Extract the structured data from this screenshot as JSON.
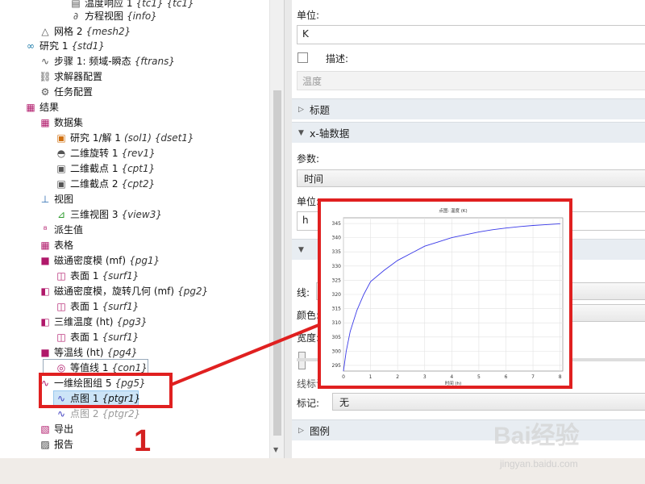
{
  "tree": {
    "rows": [
      {
        "label": "温度响应 1",
        "tag": "{tc1} {tc1}",
        "icon": "file-icon",
        "tog": ""
      },
      {
        "label": "方程视图",
        "tag": "{info}",
        "icon": "equation-icon",
        "tog": ""
      },
      {
        "label": "网格 2",
        "tag": "{mesh2}",
        "icon": "mesh-icon",
        "tog": ""
      },
      {
        "label": "研究 1",
        "tag": "{std1}",
        "icon": "study-icon",
        "tog": "◢"
      },
      {
        "label": "步骤 1: 频域-瞬态",
        "tag": "{ftrans}",
        "icon": "step-icon",
        "tog": ""
      },
      {
        "label": "求解器配置",
        "tag": "",
        "icon": "solver-icon",
        "tog": "▷"
      },
      {
        "label": "任务配置",
        "tag": "",
        "icon": "task-icon",
        "tog": ""
      },
      {
        "label": "结果",
        "tag": "",
        "icon": "results-icon",
        "tog": "◢"
      },
      {
        "label": "数据集",
        "tag": "",
        "icon": "dataset-icon",
        "tog": "◢"
      },
      {
        "label": "研究 1/解 1",
        "tag": "(sol1) {dset1}",
        "icon": "solution-icon",
        "tog": ""
      },
      {
        "label": "二维旋转 1",
        "tag": "{rev1}",
        "icon": "revolve-icon",
        "tog": ""
      },
      {
        "label": "二维截点 1",
        "tag": "{cpt1}",
        "icon": "cutpoint-icon",
        "tog": ""
      },
      {
        "label": "二维截点 2",
        "tag": "{cpt2}",
        "icon": "cutpoint-icon",
        "tog": ""
      },
      {
        "label": "视图",
        "tag": "",
        "icon": "view-icon",
        "tog": "◢"
      },
      {
        "label": "三维视图 3",
        "tag": "{view3}",
        "icon": "view3d-icon",
        "tog": "▷"
      },
      {
        "label": "派生值",
        "tag": "",
        "icon": "derived-values-icon",
        "tog": ""
      },
      {
        "label": "表格",
        "tag": "",
        "icon": "table-icon",
        "tog": ""
      },
      {
        "label": "磁通密度模 (mf)",
        "tag": "{pg1}",
        "icon": "plotgroup-2d-icon",
        "tog": "◢"
      },
      {
        "label": "表面 1",
        "tag": "{surf1}",
        "icon": "surface-icon",
        "tog": ""
      },
      {
        "label": "磁通密度模，旋转几何 (mf)",
        "tag": "{pg2}",
        "icon": "plotgroup-3d-icon",
        "tog": "◢"
      },
      {
        "label": "表面 1",
        "tag": "{surf1}",
        "icon": "surface-icon",
        "tog": ""
      },
      {
        "label": "三维温度 (ht)",
        "tag": "{pg3}",
        "icon": "plotgroup-3d-icon",
        "tog": "◢"
      },
      {
        "label": "表面 1",
        "tag": "{surf1}",
        "icon": "surface-icon",
        "tog": ""
      },
      {
        "label": "等温线 (ht)",
        "tag": "{pg4}",
        "icon": "plotgroup-2d-icon",
        "tog": "◢"
      },
      {
        "label": "等值线 1",
        "tag": "{con1}",
        "icon": "contour-icon",
        "tog": ""
      },
      {
        "label": "一维绘图组 5",
        "tag": "{pg5}",
        "icon": "plotgroup-1d-icon",
        "tog": "◢"
      },
      {
        "label": "点图 1",
        "tag": "{ptgr1}",
        "icon": "pointgraph-icon",
        "tog": ""
      },
      {
        "label": "点图 2",
        "tag": "{ptgr2}",
        "icon": "pointgraph-icon",
        "tog": ""
      },
      {
        "label": "导出",
        "tag": "",
        "icon": "export-icon",
        "tog": ""
      },
      {
        "label": "报告",
        "tag": "",
        "icon": "report-icon",
        "tog": ""
      }
    ]
  },
  "settings": {
    "unit_label": "单位:",
    "unit_value": "K",
    "desc_label": "描述:",
    "desc_value": "温度",
    "title_section": "标题",
    "xaxis_section": "x-轴数据",
    "param_label": "参数:",
    "param_value": "时间",
    "xunit_label": "单位:",
    "xunit_value": "h",
    "line_label": "线:",
    "color_label": "颜色:",
    "width_label": "宽度:",
    "marker_section": "线标记",
    "marker_label": "标记:",
    "marker_value": "无",
    "legend_section": "图例"
  },
  "annotation": {
    "number": "1"
  },
  "chart_data": {
    "type": "line",
    "title": "点图: 温度 (K)",
    "xlabel": "时间 (h)",
    "ylabel": "",
    "xlim": [
      0,
      8.1
    ],
    "ylim": [
      293,
      347
    ],
    "xticks": [
      0,
      1,
      2,
      3,
      4,
      5,
      6,
      7,
      8
    ],
    "yticks": [
      295,
      300,
      305,
      310,
      315,
      320,
      325,
      330,
      335,
      340,
      345
    ],
    "grid": true,
    "series": [
      {
        "color": "#3a3ae8",
        "x": [
          0,
          0.1,
          0.25,
          0.5,
          0.75,
          1,
          1.5,
          2,
          2.5,
          3,
          3.5,
          4,
          4.5,
          5,
          5.5,
          6,
          6.5,
          7,
          7.5,
          8
        ],
        "y": [
          293,
          300,
          307,
          314.5,
          320,
          324.5,
          328.5,
          332,
          334.5,
          337,
          338.5,
          340,
          341,
          342,
          342.8,
          343.4,
          343.9,
          344.3,
          344.6,
          344.9
        ]
      }
    ]
  },
  "watermark": {
    "brand": "Bai经验",
    "sub": "jingyan.baidu.com"
  }
}
